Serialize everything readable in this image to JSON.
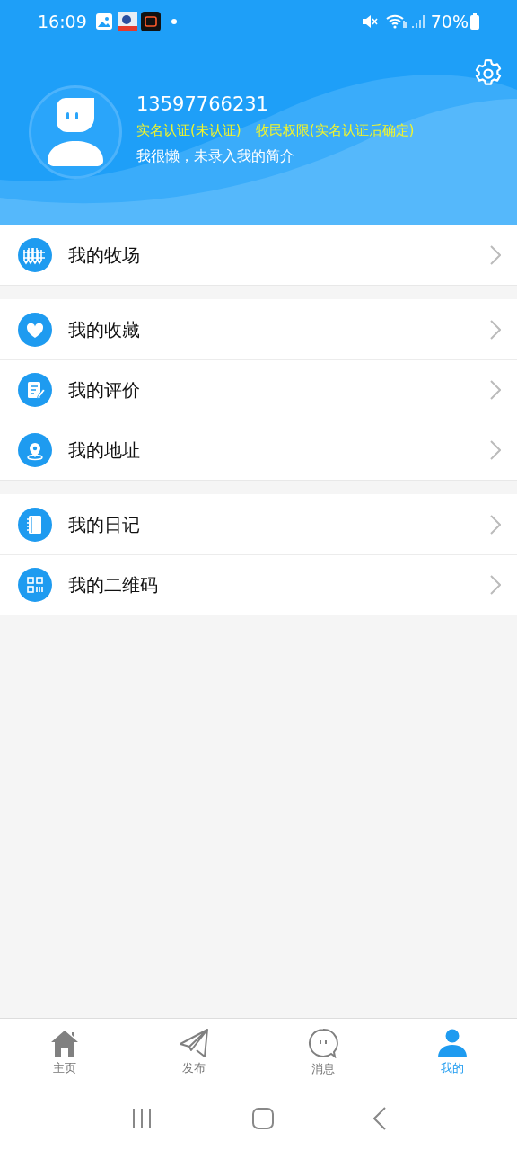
{
  "status_bar": {
    "time": "16:09",
    "battery": "70%"
  },
  "profile": {
    "phone": "13597766231",
    "verification": "实名认证(未认证)",
    "permission": "牧民权限(实名认证后确定)",
    "bio": "我很懒，未录入我的简介"
  },
  "menu_groups": [
    [
      {
        "kind": "ranch",
        "label": "我的牧场"
      }
    ],
    [
      {
        "kind": "favorite",
        "label": "我的收藏"
      },
      {
        "kind": "review",
        "label": "我的评价"
      },
      {
        "kind": "address",
        "label": "我的地址"
      }
    ],
    [
      {
        "kind": "diary",
        "label": "我的日记"
      },
      {
        "kind": "qrcode",
        "label": "我的二维码"
      }
    ]
  ],
  "tabs": [
    {
      "kind": "home",
      "label": "主页",
      "selected": false
    },
    {
      "kind": "publish",
      "label": "发布",
      "selected": false
    },
    {
      "kind": "messages",
      "label": "消息",
      "selected": false
    },
    {
      "kind": "me",
      "label": "我的",
      "selected": true
    }
  ]
}
